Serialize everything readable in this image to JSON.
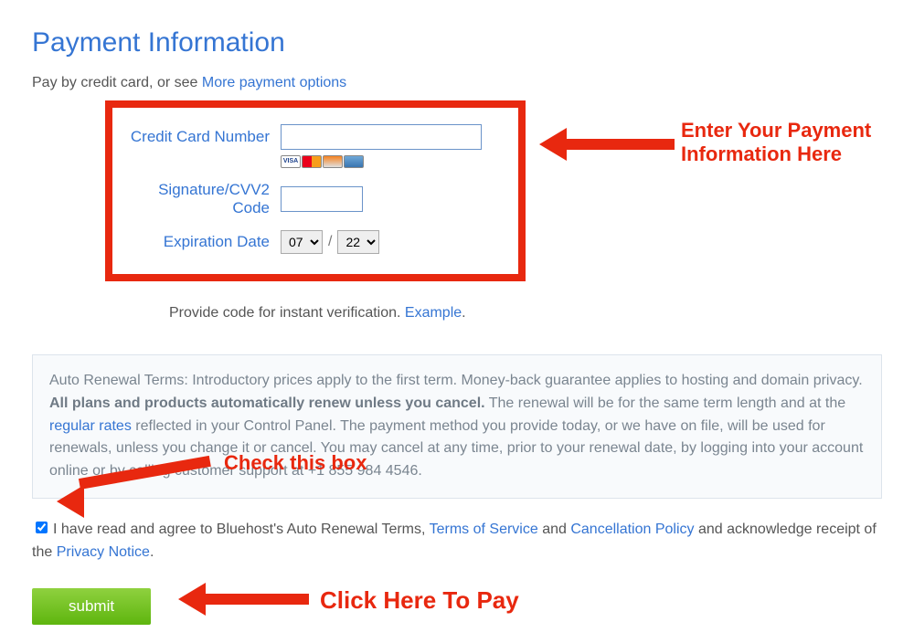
{
  "heading": "Payment Information",
  "subhead_prefix": "Pay by credit card, or see ",
  "subhead_link": "More payment options",
  "form": {
    "cc_label": "Credit Card Number",
    "cvv_label": "Signature/CVV2 Code",
    "exp_label": "Expiration Date",
    "exp_month": "07",
    "exp_year": "22"
  },
  "verify_prefix": "Provide code for instant verification. ",
  "verify_link": "Example",
  "terms": {
    "lead": "Auto Renewal Terms: Introductory prices apply to the first term. Money-back guarantee applies to hosting and domain privacy. ",
    "bold": "All plans and products automatically renew unless you cancel.",
    "mid": " The renewal will be for the same term length and at the ",
    "rates_link": "regular rates",
    "tail": " reflected in your Control Panel. The payment method you provide today, or we have on file, will be used for renewals, unless you change it or cancel. You may cancel at any time, prior to your renewal date, by logging into your account online or by calling customer support at +1 855 984 4546."
  },
  "agree": {
    "a": "I have read and agree to Bluehost's Auto Renewal Terms, ",
    "tos": "Terms of Service",
    "and1": " and ",
    "cancel": "Cancellation Policy",
    "b": " and acknowledge receipt of the ",
    "privacy": "Privacy Notice",
    "dot": "."
  },
  "submit": "submit",
  "callouts": {
    "enter1": "Enter Your Payment",
    "enter2": "Information Here",
    "check": "Check this box",
    "pay": "Click Here To Pay"
  }
}
